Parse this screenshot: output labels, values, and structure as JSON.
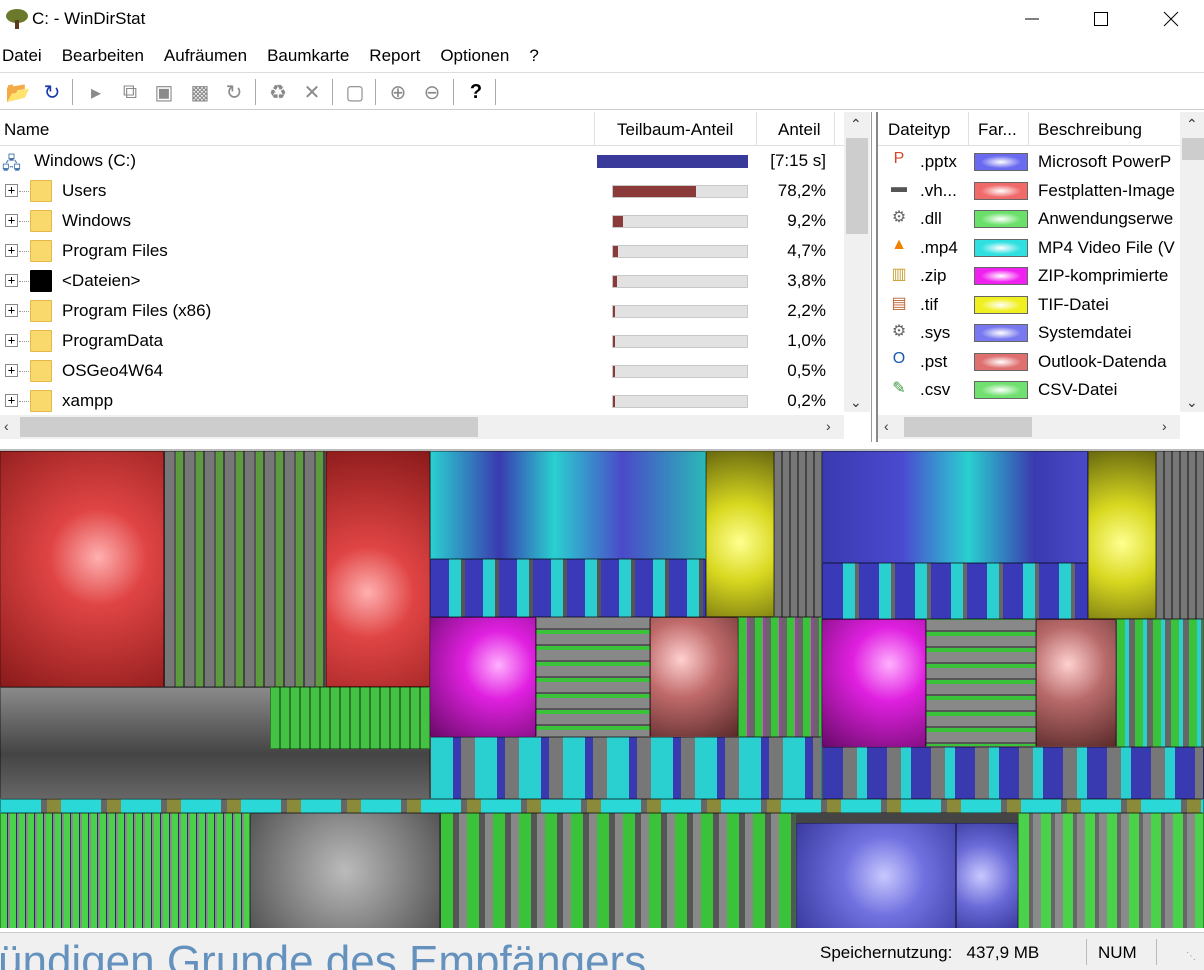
{
  "window": {
    "title": "C: - WinDirStat",
    "minimize_icon": "minimize-icon",
    "maximize_icon": "maximize-icon",
    "close_icon": "close-icon"
  },
  "menu": [
    "Datei",
    "Bearbeiten",
    "Aufräumen",
    "Baumkarte",
    "Report",
    "Optionen",
    "?"
  ],
  "toolbar": {
    "icons": [
      "open-folder-icon",
      "refresh-icon",
      "play-icon",
      "copy-path-icon",
      "explorer-icon",
      "command-prompt-icon",
      "refresh-selected-icon",
      "recycle-icon",
      "delete-icon",
      "properties-icon",
      "zoom-in-icon",
      "zoom-out-icon",
      "help-icon"
    ]
  },
  "tree": {
    "columns": {
      "name": "Name",
      "subtree": "Teilbaum-Anteil",
      "share": "Anteil"
    },
    "root": {
      "name": "Windows (C:)",
      "share": "[7:15 s]",
      "fill": 1.0
    },
    "rows": [
      {
        "name": "Users",
        "share": "78,2%",
        "fill": 0.782,
        "icon": "folder-icon"
      },
      {
        "name": "Windows",
        "share": "9,2%",
        "fill": 0.092,
        "icon": "folder-icon"
      },
      {
        "name": "Program Files",
        "share": "4,7%",
        "fill": 0.047,
        "icon": "folder-icon"
      },
      {
        "name": "<Dateien>",
        "share": "3,8%",
        "fill": 0.038,
        "icon": "files-icon"
      },
      {
        "name": "Program Files (x86)",
        "share": "2,2%",
        "fill": 0.022,
        "icon": "folder-icon"
      },
      {
        "name": "ProgramData",
        "share": "1,0%",
        "fill": 0.01,
        "icon": "folder-icon"
      },
      {
        "name": "OSGeo4W64",
        "share": "0,5%",
        "fill": 0.005,
        "icon": "folder-icon"
      },
      {
        "name": "xampp",
        "share": "0,2%",
        "fill": 0.002,
        "icon": "folder-icon"
      }
    ]
  },
  "types": {
    "columns": {
      "type": "Dateityp",
      "color": "Far...",
      "desc": "Beschreibung"
    },
    "rows": [
      {
        "ext": ".pptx",
        "color": "#6a6af0",
        "desc": "Microsoft PowerP",
        "icon": "powerpoint-icon"
      },
      {
        "ext": ".vh...",
        "color": "#f06a6a",
        "desc": "Festplatten-Image",
        "icon": "disk-icon"
      },
      {
        "ext": ".dll",
        "color": "#6ae06a",
        "desc": "Anwendungserwe",
        "icon": "dll-icon"
      },
      {
        "ext": ".mp4",
        "color": "#30e0e0",
        "desc": "MP4 Video File (V",
        "icon": "vlc-icon"
      },
      {
        "ext": ".zip",
        "color": "#f020f0",
        "desc": "ZIP-komprimierte",
        "icon": "zip-icon"
      },
      {
        "ext": ".tif",
        "color": "#f0f020",
        "desc": "TIF-Datei",
        "icon": "image-icon"
      },
      {
        "ext": ".sys",
        "color": "#7878f0",
        "desc": "Systemdatei",
        "icon": "sys-icon"
      },
      {
        "ext": ".pst",
        "color": "#e07070",
        "desc": "Outlook-Datenda",
        "icon": "outlook-icon"
      },
      {
        "ext": ".csv",
        "color": "#70e070",
        "desc": "CSV-Datei",
        "icon": "csv-icon"
      }
    ]
  },
  "status": {
    "background_text": "ündigen Grunde des Empfängers",
    "memory_label": "Speichernutzung:",
    "memory_value": "437,9 MB",
    "num": "NUM"
  }
}
